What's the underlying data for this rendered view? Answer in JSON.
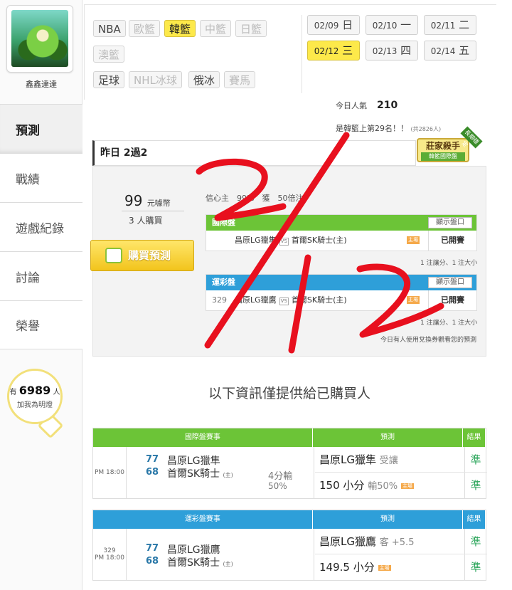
{
  "sidebar": {
    "username": "鑫鑫達達",
    "nav": [
      "預測",
      "戰績",
      "遊戲紀錄",
      "討論",
      "榮譽"
    ],
    "fans": {
      "prefix": "有",
      "count": "6989",
      "suffix": "人",
      "line2": "加我為明燈"
    }
  },
  "filters": {
    "row1": [
      "NBA",
      "歐籃",
      "韓籃",
      "中籃",
      "日籃"
    ],
    "row2": [
      "澳籃"
    ],
    "row3": [
      "足球",
      "NHL冰球",
      "俄冰",
      "賽馬"
    ],
    "selected": "韓籃"
  },
  "dates": [
    {
      "d": "02/09",
      "w": "日"
    },
    {
      "d": "02/10",
      "w": "一"
    },
    {
      "d": "02/11",
      "w": "二"
    },
    {
      "d": "02/12",
      "w": "三"
    },
    {
      "d": "02/13",
      "w": "四"
    },
    {
      "d": "02/14",
      "w": "五"
    }
  ],
  "popularity": {
    "label": "今日人氣",
    "value": "210",
    "rank_text": "是韓籃上第29名！！",
    "total": "(共2826人)"
  },
  "badge": {
    "title": "莊家殺手",
    "sub": "韓籃國際盤",
    "ribbon": "長期穩定"
  },
  "yesterday": {
    "label": "昨日 2過2"
  },
  "purchase": {
    "price": "99",
    "unit": "元噱幣",
    "buyers": "3 人購買",
    "button": "購買預測",
    "confidence": "信心主　99%　獲　50倍注"
  },
  "mini_tables": [
    {
      "title": "國際盤",
      "color": "#6cc437",
      "show_label": "顯示盤口",
      "num": "",
      "away": "昌原LG獵隼",
      "home": "首爾SK騎士(主)",
      "host_tag": "主場",
      "status": "已開賽",
      "note": "1 注讓分、1 注大小"
    },
    {
      "title": "運彩盤",
      "color": "#2e9fd9",
      "show_label": "顯示盤口",
      "num": "329",
      "away": "昌原LG獵鷹",
      "home": "首爾SK騎士(主)",
      "host_tag": "主場",
      "status": "已開賽",
      "note": "1 注讓分、1 注大小"
    }
  ],
  "exchange_note": "今日有人使用兌換券觀看您的預測",
  "info_text": "以下資訊僅提供給已購買人",
  "results": [
    {
      "header": [
        "國際盤賽事",
        "預測",
        "結果"
      ],
      "num": "",
      "time": "PM 18:00",
      "away_score": "77",
      "home_score": "68",
      "away": "昌原LG獵隼",
      "home": "首爾SK騎士",
      "home_tag": "(主)",
      "diff": "4分輸",
      "diff_pct": "50%",
      "pred1": "昌原LG獵隼",
      "pred1_sub": "受讓",
      "pred2": "150 小分",
      "pred2_sub": "輸50%",
      "result1": "準",
      "result2": "準"
    },
    {
      "header": [
        "運彩盤賽事",
        "預測",
        "結果"
      ],
      "num": "329",
      "time": "PM 18:00",
      "away_score": "77",
      "home_score": "68",
      "away": "昌原LG獵鷹",
      "home": "首爾SK騎士",
      "home_tag": "(主)",
      "diff": "",
      "diff_pct": "",
      "pred1": "昌原LG獵鷹",
      "pred1_sub": "客 +5.5",
      "pred2": "149.5 小分",
      "pred2_sub": "",
      "result1": "準",
      "result2": "準"
    }
  ],
  "host_tag": "主場",
  "handwriting": "2/12",
  "colors": {
    "accent_yellow": "#fde94a",
    "green": "#6cc437",
    "blue": "#2e9fd9",
    "ink_red": "#e8101e",
    "win": "#2aa55a"
  }
}
